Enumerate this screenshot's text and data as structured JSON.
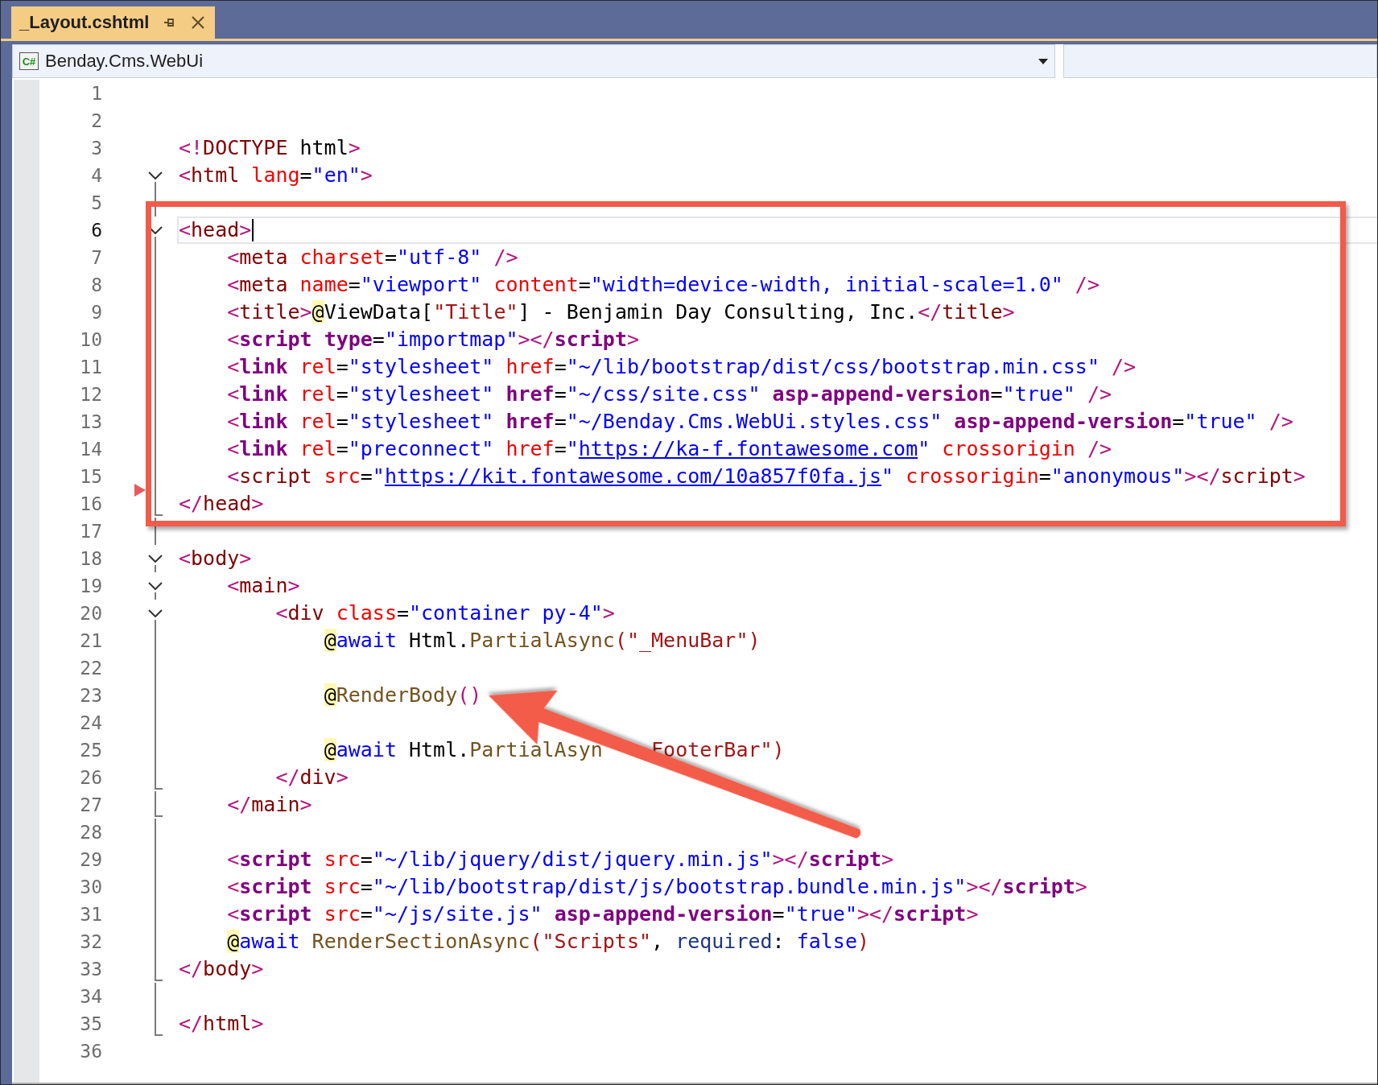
{
  "tab": {
    "title": "_Layout.cshtml",
    "selected": true
  },
  "navigation_bar": {
    "project_icon_text": "C#",
    "project": "Benday.Cms.WebUi"
  },
  "editor": {
    "lines": [
      {
        "number": "1",
        "current": false,
        "marker": false
      },
      {
        "number": "2",
        "current": false,
        "marker": false
      },
      {
        "number": "3",
        "current": false,
        "marker": false,
        "tokens": [
          {
            "kind": "punct",
            "text": "<!"
          },
          {
            "kind": "tag",
            "text": "DOCTYPE"
          },
          {
            "kind": "plain",
            "text": " html"
          },
          {
            "kind": "punct",
            "text": ">"
          }
        ]
      },
      {
        "number": "4",
        "fold": {
          "kind": "open"
        },
        "current": false,
        "marker": false,
        "tokens": [
          {
            "kind": "punct",
            "text": "<"
          },
          {
            "kind": "tag",
            "text": "html"
          },
          {
            "kind": "attr",
            "text": " lang"
          },
          {
            "kind": "plain",
            "text": "="
          },
          {
            "kind": "value",
            "text": "\"en\""
          },
          {
            "kind": "punct",
            "text": ">"
          }
        ]
      },
      {
        "number": "5",
        "fold": {
          "kind": "line"
        },
        "current": false,
        "marker": false
      },
      {
        "number": "6",
        "fold": {
          "kind": "open"
        },
        "current": true,
        "marker": false,
        "tokens": [
          {
            "kind": "punct",
            "text": "<"
          },
          {
            "kind": "tag",
            "text": "head"
          },
          {
            "kind": "punct",
            "text": ">"
          }
        ]
      },
      {
        "number": "7",
        "fold": {
          "kind": "line"
        },
        "current": false,
        "marker": false,
        "tokens": [
          {
            "kind": "punct",
            "text": "    <"
          },
          {
            "kind": "tag",
            "text": "meta"
          },
          {
            "kind": "attr",
            "text": " charset"
          },
          {
            "kind": "plain",
            "text": "="
          },
          {
            "kind": "value",
            "text": "\"utf-8\""
          },
          {
            "kind": "punct",
            "text": " />"
          }
        ]
      },
      {
        "number": "8",
        "fold": {
          "kind": "line"
        },
        "current": false,
        "marker": false,
        "tokens": [
          {
            "kind": "punct",
            "text": "    <"
          },
          {
            "kind": "tag",
            "text": "meta"
          },
          {
            "kind": "attr",
            "text": " name"
          },
          {
            "kind": "plain",
            "text": "="
          },
          {
            "kind": "value",
            "text": "\"viewport\""
          },
          {
            "kind": "attr",
            "text": " content"
          },
          {
            "kind": "plain",
            "text": "="
          },
          {
            "kind": "value",
            "text": "\"width=device-width, initial-scale=1.0\""
          },
          {
            "kind": "punct",
            "text": " />"
          }
        ]
      },
      {
        "number": "9",
        "fold": {
          "kind": "line"
        },
        "current": false,
        "marker": false,
        "tokens": [
          {
            "kind": "punct",
            "text": "    <"
          },
          {
            "kind": "tag",
            "text": "title"
          },
          {
            "kind": "punct",
            "text": ">"
          },
          {
            "kind": "at",
            "text": "@"
          },
          {
            "kind": "plain",
            "text": "ViewData["
          },
          {
            "kind": "string",
            "text": "\"Title\""
          },
          {
            "kind": "plain",
            "text": "] - Benjamin Day Consulting, Inc."
          },
          {
            "kind": "punct",
            "text": "</"
          },
          {
            "kind": "tag",
            "text": "title"
          },
          {
            "kind": "punct",
            "text": ">"
          }
        ]
      },
      {
        "number": "10",
        "fold": {
          "kind": "line"
        },
        "current": false,
        "marker": false,
        "tokens": [
          {
            "kind": "punct",
            "text": "    <"
          },
          {
            "kind": "helper",
            "text": "script"
          },
          {
            "kind": "helper",
            "text": " type"
          },
          {
            "kind": "plain",
            "text": "="
          },
          {
            "kind": "value",
            "text": "\"importmap\""
          },
          {
            "kind": "punct",
            "text": "></"
          },
          {
            "kind": "helper",
            "text": "script"
          },
          {
            "kind": "punct",
            "text": ">"
          }
        ]
      },
      {
        "number": "11",
        "fold": {
          "kind": "line"
        },
        "current": false,
        "marker": false,
        "tokens": [
          {
            "kind": "punct",
            "text": "    <"
          },
          {
            "kind": "helper",
            "text": "link"
          },
          {
            "kind": "attr",
            "text": " rel"
          },
          {
            "kind": "plain",
            "text": "="
          },
          {
            "kind": "value",
            "text": "\"stylesheet\""
          },
          {
            "kind": "attr",
            "text": " href"
          },
          {
            "kind": "plain",
            "text": "="
          },
          {
            "kind": "value",
            "text": "\"~/lib/bootstrap/dist/css/bootstrap.min.css\""
          },
          {
            "kind": "punct",
            "text": " />"
          }
        ]
      },
      {
        "number": "12",
        "fold": {
          "kind": "line"
        },
        "current": false,
        "marker": false,
        "tokens": [
          {
            "kind": "punct",
            "text": "    <"
          },
          {
            "kind": "helper",
            "text": "link"
          },
          {
            "kind": "attr",
            "text": " rel"
          },
          {
            "kind": "plain",
            "text": "="
          },
          {
            "kind": "value",
            "text": "\"stylesheet\""
          },
          {
            "kind": "helper",
            "text": " href"
          },
          {
            "kind": "plain",
            "text": "="
          },
          {
            "kind": "value",
            "text": "\"~/css/site.css\""
          },
          {
            "kind": "helper",
            "text": " asp-append-version"
          },
          {
            "kind": "plain",
            "text": "="
          },
          {
            "kind": "value",
            "text": "\"true\""
          },
          {
            "kind": "punct",
            "text": " />"
          }
        ]
      },
      {
        "number": "13",
        "fold": {
          "kind": "line"
        },
        "current": false,
        "marker": false,
        "tokens": [
          {
            "kind": "punct",
            "text": "    <"
          },
          {
            "kind": "helper",
            "text": "link"
          },
          {
            "kind": "attr",
            "text": " rel"
          },
          {
            "kind": "plain",
            "text": "="
          },
          {
            "kind": "value",
            "text": "\"stylesheet\""
          },
          {
            "kind": "helper",
            "text": " href"
          },
          {
            "kind": "plain",
            "text": "="
          },
          {
            "kind": "value",
            "text": "\"~/Benday.Cms.WebUi.styles.css\""
          },
          {
            "kind": "helper",
            "text": " asp-append-version"
          },
          {
            "kind": "plain",
            "text": "="
          },
          {
            "kind": "value",
            "text": "\"true\""
          },
          {
            "kind": "punct",
            "text": " />"
          }
        ]
      },
      {
        "number": "14",
        "fold": {
          "kind": "line"
        },
        "current": false,
        "marker": false,
        "tokens": [
          {
            "kind": "punct",
            "text": "    <"
          },
          {
            "kind": "helper",
            "text": "link"
          },
          {
            "kind": "attr",
            "text": " rel"
          },
          {
            "kind": "plain",
            "text": "="
          },
          {
            "kind": "value",
            "text": "\"preconnect\""
          },
          {
            "kind": "attr",
            "text": " href"
          },
          {
            "kind": "plain",
            "text": "="
          },
          {
            "kind": "value",
            "text": "\""
          },
          {
            "kind": "link",
            "text": "https://ka-f.fontawesome.com"
          },
          {
            "kind": "value",
            "text": "\""
          },
          {
            "kind": "attr",
            "text": " crossorigin"
          },
          {
            "kind": "punct",
            "text": " />"
          }
        ]
      },
      {
        "number": "15",
        "fold": {
          "kind": "line"
        },
        "current": false,
        "marker": false,
        "tokens": [
          {
            "kind": "punct",
            "text": "    <"
          },
          {
            "kind": "tag",
            "text": "script"
          },
          {
            "kind": "attr",
            "text": " src"
          },
          {
            "kind": "plain",
            "text": "="
          },
          {
            "kind": "value",
            "text": "\""
          },
          {
            "kind": "link",
            "text": "https://kit.fontawesome.com/10a857f0fa.js"
          },
          {
            "kind": "value",
            "text": "\""
          },
          {
            "kind": "attr",
            "text": " crossorigin"
          },
          {
            "kind": "plain",
            "text": "="
          },
          {
            "kind": "value",
            "text": "\"anonymous\""
          },
          {
            "kind": "punct",
            "text": "></"
          },
          {
            "kind": "tag",
            "text": "script"
          },
          {
            "kind": "punct",
            "text": ">"
          }
        ]
      },
      {
        "number": "16",
        "fold": {
          "kind": "end"
        },
        "current": false,
        "marker": true,
        "tokens": [
          {
            "kind": "punct",
            "text": "</"
          },
          {
            "kind": "tag",
            "text": "head"
          },
          {
            "kind": "punct",
            "text": ">"
          }
        ]
      },
      {
        "number": "17",
        "fold": {
          "kind": "line"
        },
        "current": false,
        "marker": false
      },
      {
        "number": "18",
        "fold": {
          "kind": "open"
        },
        "current": false,
        "marker": false,
        "tokens": [
          {
            "kind": "punct",
            "text": "<"
          },
          {
            "kind": "tag",
            "text": "body"
          },
          {
            "kind": "punct",
            "text": ">"
          }
        ]
      },
      {
        "number": "19",
        "fold": {
          "kind": "open"
        },
        "current": false,
        "marker": false,
        "tokens": [
          {
            "kind": "punct",
            "text": "    <"
          },
          {
            "kind": "tag",
            "text": "main"
          },
          {
            "kind": "punct",
            "text": ">"
          }
        ]
      },
      {
        "number": "20",
        "fold": {
          "kind": "open"
        },
        "current": false,
        "marker": false,
        "tokens": [
          {
            "kind": "punct",
            "text": "        <"
          },
          {
            "kind": "tag",
            "text": "div"
          },
          {
            "kind": "attr",
            "text": " class"
          },
          {
            "kind": "plain",
            "text": "="
          },
          {
            "kind": "value",
            "text": "\"container py-4\""
          },
          {
            "kind": "punct",
            "text": ">"
          }
        ]
      },
      {
        "number": "21",
        "fold": {
          "kind": "line"
        },
        "current": false,
        "marker": false,
        "tokens": [
          {
            "kind": "at",
            "text": "            @"
          },
          {
            "kind": "keyword",
            "text": "await"
          },
          {
            "kind": "plain",
            "text": " Html."
          },
          {
            "kind": "method",
            "text": "PartialAsync"
          },
          {
            "kind": "string",
            "text": "(\"_MenuBar\")"
          }
        ]
      },
      {
        "number": "22",
        "fold": {
          "kind": "line"
        },
        "current": false,
        "marker": false
      },
      {
        "number": "23",
        "fold": {
          "kind": "line"
        },
        "current": false,
        "marker": false,
        "tokens": [
          {
            "kind": "at",
            "text": "            @"
          },
          {
            "kind": "method",
            "text": "RenderBody"
          },
          {
            "kind": "punct",
            "text": "()"
          }
        ]
      },
      {
        "number": "24",
        "fold": {
          "kind": "line"
        },
        "current": false,
        "marker": false
      },
      {
        "number": "25",
        "fold": {
          "kind": "line"
        },
        "current": false,
        "marker": false,
        "tokens": [
          {
            "kind": "at",
            "text": "            @"
          },
          {
            "kind": "keyword",
            "text": "await"
          },
          {
            "kind": "plain",
            "text": " Html."
          },
          {
            "kind": "method",
            "text": "PartialAsyn"
          },
          {
            "kind": "string",
            "text": "    FooterBar\")"
          }
        ]
      },
      {
        "number": "26",
        "fold": {
          "kind": "end"
        },
        "current": false,
        "marker": false,
        "tokens": [
          {
            "kind": "punct",
            "text": "        </"
          },
          {
            "kind": "tag",
            "text": "div"
          },
          {
            "kind": "punct",
            "text": ">"
          }
        ]
      },
      {
        "number": "27",
        "fold": {
          "kind": "end"
        },
        "current": false,
        "marker": false,
        "tokens": [
          {
            "kind": "punct",
            "text": "    </"
          },
          {
            "kind": "tag",
            "text": "main"
          },
          {
            "kind": "punct",
            "text": ">"
          }
        ]
      },
      {
        "number": "28",
        "fold": {
          "kind": "line"
        },
        "current": false,
        "marker": false
      },
      {
        "number": "29",
        "fold": {
          "kind": "line"
        },
        "current": false,
        "marker": false,
        "tokens": [
          {
            "kind": "punct",
            "text": "    <"
          },
          {
            "kind": "helper",
            "text": "script"
          },
          {
            "kind": "attr",
            "text": " src"
          },
          {
            "kind": "plain",
            "text": "="
          },
          {
            "kind": "value",
            "text": "\"~/lib/jquery/dist/jquery.min.js\""
          },
          {
            "kind": "punct",
            "text": "></"
          },
          {
            "kind": "helper",
            "text": "script"
          },
          {
            "kind": "punct",
            "text": ">"
          }
        ]
      },
      {
        "number": "30",
        "fold": {
          "kind": "line"
        },
        "current": false,
        "marker": false,
        "tokens": [
          {
            "kind": "punct",
            "text": "    <"
          },
          {
            "kind": "helper",
            "text": "script"
          },
          {
            "kind": "attr",
            "text": " src"
          },
          {
            "kind": "plain",
            "text": "="
          },
          {
            "kind": "value",
            "text": "\"~/lib/bootstrap/dist/js/bootstrap.bundle.min.js\""
          },
          {
            "kind": "punct",
            "text": "></"
          },
          {
            "kind": "helper",
            "text": "script"
          },
          {
            "kind": "punct",
            "text": ">"
          }
        ]
      },
      {
        "number": "31",
        "fold": {
          "kind": "line"
        },
        "current": false,
        "marker": false,
        "tokens": [
          {
            "kind": "punct",
            "text": "    <"
          },
          {
            "kind": "helper",
            "text": "script"
          },
          {
            "kind": "attr",
            "text": " src"
          },
          {
            "kind": "plain",
            "text": "="
          },
          {
            "kind": "value",
            "text": "\"~/js/site.js\""
          },
          {
            "kind": "helper",
            "text": " asp-append-version"
          },
          {
            "kind": "plain",
            "text": "="
          },
          {
            "kind": "value",
            "text": "\"true\""
          },
          {
            "kind": "punct",
            "text": "></"
          },
          {
            "kind": "helper",
            "text": "script"
          },
          {
            "kind": "punct",
            "text": ">"
          }
        ]
      },
      {
        "number": "32",
        "fold": {
          "kind": "line"
        },
        "current": false,
        "marker": false,
        "tokens": [
          {
            "kind": "at",
            "text": "    @"
          },
          {
            "kind": "keyword",
            "text": "await"
          },
          {
            "kind": "method",
            "text": " RenderSectionAsync"
          },
          {
            "kind": "string",
            "text": "(\"Scripts\""
          },
          {
            "kind": "plain",
            "text": ", "
          },
          {
            "kind": "param",
            "text": "required"
          },
          {
            "kind": "plain",
            "text": ": "
          },
          {
            "kind": "keyword",
            "text": "false"
          },
          {
            "kind": "string",
            "text": ")"
          }
        ]
      },
      {
        "number": "33",
        "fold": {
          "kind": "end"
        },
        "current": false,
        "marker": false,
        "tokens": [
          {
            "kind": "punct",
            "text": "</"
          },
          {
            "kind": "tag",
            "text": "body"
          },
          {
            "kind": "punct",
            "text": ">"
          }
        ]
      },
      {
        "number": "34",
        "fold": {
          "kind": "line"
        },
        "current": false,
        "marker": false
      },
      {
        "number": "35",
        "fold": {
          "kind": "end"
        },
        "current": false,
        "marker": false,
        "tokens": [
          {
            "kind": "punct",
            "text": "</"
          },
          {
            "kind": "tag",
            "text": "html"
          },
          {
            "kind": "punct",
            "text": ">"
          }
        ]
      },
      {
        "number": "36",
        "current": false,
        "marker": false
      }
    ]
  }
}
